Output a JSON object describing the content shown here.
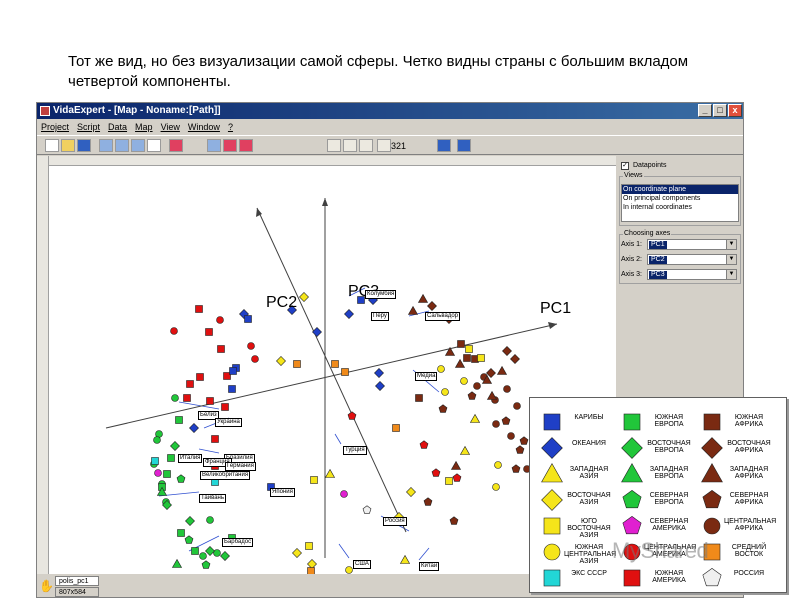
{
  "caption": "Тот же вид, но без визуализации самой сферы. Четко видны страны с большим вкладом четвертой компоненты.",
  "window": {
    "title": "VidaExpert - [Map - Noname:[Path]]",
    "controls": [
      "_",
      "□",
      "x"
    ]
  },
  "menu": [
    "Project",
    "Script",
    "Data",
    "Map",
    "View",
    "Window",
    "?"
  ],
  "toolbar": {
    "zoom": "321"
  },
  "canvas": {
    "axes": {
      "pc1": "PC1",
      "pc2": "PC2",
      "pc3": "PC3"
    },
    "countries": [
      "Колумбия",
      "Перу",
      "Сальвадор",
      "Медиа",
      "Белиз",
      "Украина",
      "Бразилия",
      "Турция",
      "Тайвань",
      "Россия",
      "Барбадос",
      "США",
      "Китай",
      "Италия",
      "Франция",
      "Германия",
      "Великобритания",
      "Япония"
    ]
  },
  "panel": {
    "datapoints_label": "Datapoints",
    "views_label": "Views",
    "views": [
      "On coordinate plane",
      "On principal components",
      "In internal coordinates"
    ],
    "choosing_axes_label": "Choosing axes",
    "axes": [
      {
        "label": "Axis 1:",
        "value": "PC1"
      },
      {
        "label": "Axis 2:",
        "value": "PC2"
      },
      {
        "label": "Axis 3:",
        "value": "PC3"
      }
    ]
  },
  "status": {
    "tab": "polis_pc1",
    "size": "807x584"
  },
  "legend": {
    "items": [
      {
        "label": "КАРИБЫ",
        "shape": "square",
        "color": "#1f3fc6"
      },
      {
        "label": "ЮЖНАЯ ЕВРОПА",
        "shape": "square",
        "color": "#21c63a"
      },
      {
        "label": "ЮЖНАЯ АФРИКА",
        "shape": "square",
        "color": "#7a2a12"
      },
      {
        "label": "ОКЕАНИЯ",
        "shape": "diamond",
        "color": "#1f3fc6"
      },
      {
        "label": "ВОСТОЧНАЯ ЕВРОПА",
        "shape": "diamond",
        "color": "#21c63a"
      },
      {
        "label": "ВОСТОЧНАЯ АФРИКА",
        "shape": "diamond",
        "color": "#7a2a12"
      },
      {
        "label": "ЗАПАДНАЯ АЗИЯ",
        "shape": "triangle",
        "color": "#f5e51a"
      },
      {
        "label": "ЗАПАДНАЯ ЕВРОПА",
        "shape": "triangle",
        "color": "#21c63a"
      },
      {
        "label": "ЗАПАДНАЯ АФРИКА",
        "shape": "triangle",
        "color": "#7a2a12"
      },
      {
        "label": "ВОСТОЧНАЯ АЗИЯ",
        "shape": "diamond",
        "color": "#f5e51a"
      },
      {
        "label": "СЕВЕРНАЯ ЕВРОПА",
        "shape": "pentagon",
        "color": "#21c63a"
      },
      {
        "label": "СЕВЕРНАЯ АФРИКА",
        "shape": "pentagon",
        "color": "#7a2a12"
      },
      {
        "label": "ЮГО ВОСТОЧНАЯ АЗИЯ",
        "shape": "square",
        "color": "#f5e51a"
      },
      {
        "label": "СЕВЕРНАЯ АМЕРИКА",
        "shape": "pentagon",
        "color": "#e020d0"
      },
      {
        "label": "ЦЕНТРАЛЬНАЯ АФРИКА",
        "shape": "circle",
        "color": "#7a2a12"
      },
      {
        "label": "ЮЖНАЯ ЦЕНТРАЛЬНАЯ АЗИЯ",
        "shape": "circle",
        "color": "#f5e51a"
      },
      {
        "label": "ЦЕНТРАЛЬНАЯ АМЕРИКА",
        "shape": "circle",
        "color": "#e01010"
      },
      {
        "label": "СРЕДНИЙ ВОСТОК",
        "shape": "square",
        "color": "#f08a1a"
      },
      {
        "label": "ЭКС СССР",
        "shape": "square",
        "color": "#22d6d6"
      },
      {
        "label": "ЮЖНАЯ АМЕРИКА",
        "shape": "square",
        "color": "#e01010"
      },
      {
        "label": "РОССИЯ",
        "shape": "pentagon",
        "color": "#f0f0f0"
      }
    ]
  },
  "watermark": "MyShared"
}
